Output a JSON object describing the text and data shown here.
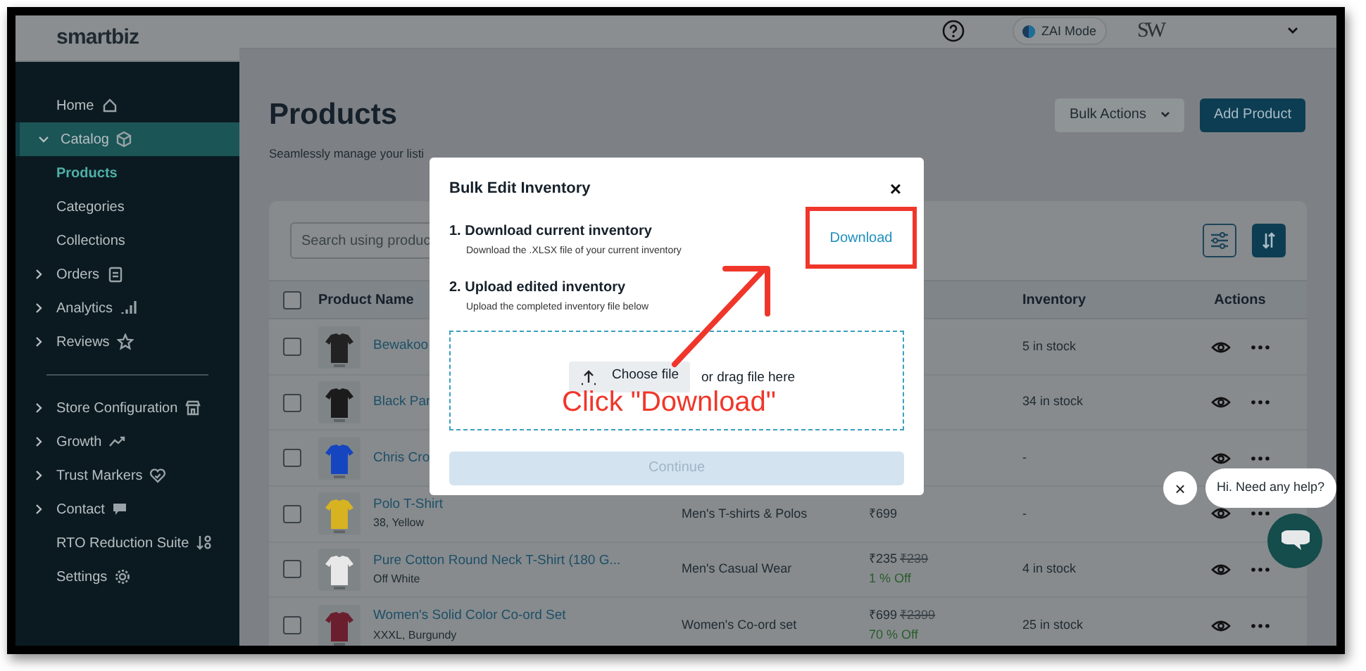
{
  "sidebar": {
    "logo": "smartbiz",
    "sections": [
      [
        {
          "label": "Home",
          "kind": "link",
          "selected": false
        },
        {
          "label": "Catalog",
          "kind": "group",
          "expanded": true,
          "selected": true,
          "children": [
            {
              "label": "Products",
              "selected": true
            },
            {
              "label": "Categories",
              "selected": false
            },
            {
              "label": "Collections",
              "selected": false
            }
          ]
        },
        {
          "label": "Orders",
          "kind": "group",
          "expanded": false,
          "selected": false
        },
        {
          "label": "Analytics",
          "kind": "group",
          "expanded": false,
          "selected": false
        },
        {
          "label": "Reviews",
          "kind": "group",
          "expanded": false,
          "selected": false
        }
      ],
      [
        {
          "label": "Store Configuration",
          "kind": "group",
          "expanded": false,
          "selected": false
        },
        {
          "label": "Growth",
          "kind": "group",
          "expanded": false,
          "selected": false
        },
        {
          "label": "Trust Markers",
          "kind": "group",
          "expanded": false,
          "selected": false
        },
        {
          "label": "Contact",
          "kind": "group",
          "expanded": false,
          "selected": false
        },
        {
          "label": "RTO Reduction Suite",
          "kind": "link",
          "selected": false
        },
        {
          "label": "Settings",
          "kind": "link",
          "selected": false
        }
      ]
    ]
  },
  "header": {
    "mode_label": "ZAI Mode",
    "account_logo": "SW"
  },
  "page": {
    "title": "Products",
    "subtitle": "Seamlessly manage your listi",
    "buttons": [
      "Bulk Actions",
      "Add Product"
    ]
  },
  "table": {
    "search": {
      "placeholder": "Search using produc"
    },
    "all_checked": false,
    "columns": [
      "Product Name",
      "Inventory",
      "Actions"
    ],
    "rows": [
      {
        "name": "Bewakoo",
        "inventory": "5 in stock",
        "checked": false
      },
      {
        "name": "Black Par",
        "inventory": "34 in stock",
        "checked": false
      },
      {
        "name": "Chris Cro",
        "inventory": "-",
        "checked": false
      },
      {
        "name": "Polo T-Shirt",
        "variant": "38, Yellow",
        "category": "Men's T-shirts & Polos",
        "price": "₹699",
        "inventory": "-",
        "checked": false
      },
      {
        "name": "Pure Cotton Round Neck T-Shirt (180 G...",
        "variant": "Off White",
        "category": "Men's Casual Wear",
        "price": "₹235",
        "old_price": "₹239",
        "discount": "1 % Off",
        "inventory": "4 in stock",
        "checked": false
      },
      {
        "name": "Women's Solid Color Co-ord Set",
        "variant": "XXXL, Burgundy",
        "category": "Women's Co-ord set",
        "price": "₹699",
        "old_price": "₹2399",
        "discount": "70 % Off",
        "inventory": "25 in stock",
        "checked": false
      }
    ]
  },
  "modal": {
    "title": "Bulk Edit Inventory",
    "close": "×",
    "steps": [
      {
        "heading": "1. Download current inventory",
        "hint": "Download the .XLSX file of your current inventory"
      },
      {
        "heading": "2. Upload edited inventory",
        "hint": "Upload the completed inventory file below"
      }
    ],
    "download_link": "Download",
    "choose_file": "Choose file",
    "drag_hint": "or drag file here",
    "continue": {
      "label": "Continue",
      "disabled": true
    }
  },
  "annotation": {
    "text": "Click \"Download\""
  },
  "chat": {
    "close": "×",
    "message": "Hi. Need any help?"
  }
}
